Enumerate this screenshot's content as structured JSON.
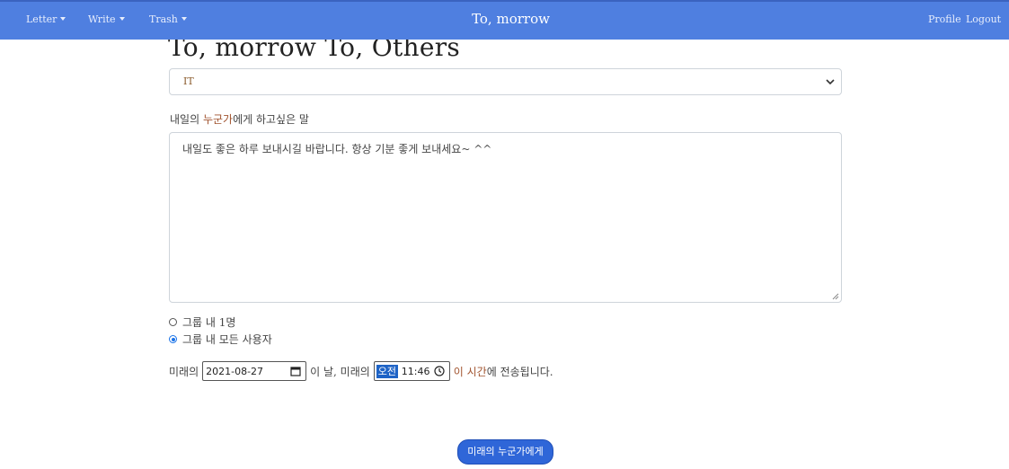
{
  "navbar": {
    "brand": "To, morrow",
    "menus": [
      {
        "label": "Letter"
      },
      {
        "label": "Write"
      },
      {
        "label": "Trash"
      }
    ],
    "right": {
      "profile": "Profile",
      "logout": "Logout"
    }
  },
  "page": {
    "title": "To, morrow To, Others"
  },
  "category": {
    "selected": "IT"
  },
  "message": {
    "label_part1": "내일의 ",
    "label_part2": "누군가",
    "label_part3": "에게 하고싶은 말",
    "text": "내일도 좋은 하루 보내시길 바랍니다. 항상 기분 좋게 보내세요~ ^^"
  },
  "recipients": {
    "option_one": "그룹 내 1명",
    "option_all": "그룹 내 모든 사용자",
    "selected": "option_all"
  },
  "schedule": {
    "prefix": "미래의",
    "date_value": "2021-08-27",
    "middle": "이 날, 미래의",
    "ampm": "오전",
    "time_value": "11:46",
    "suffix_part1": "이 시간",
    "suffix_part2": "에 전송됩니다."
  },
  "submit": {
    "label": "미래의 누군가에게"
  },
  "colors": {
    "navbar": "#4f7fe0",
    "button": "#2f66d8",
    "accent_text": "#a0522d"
  },
  "icons": [
    "caret-down-icon",
    "chevron-down-icon",
    "calendar-icon",
    "clock-icon",
    "resize-grip-icon"
  ]
}
